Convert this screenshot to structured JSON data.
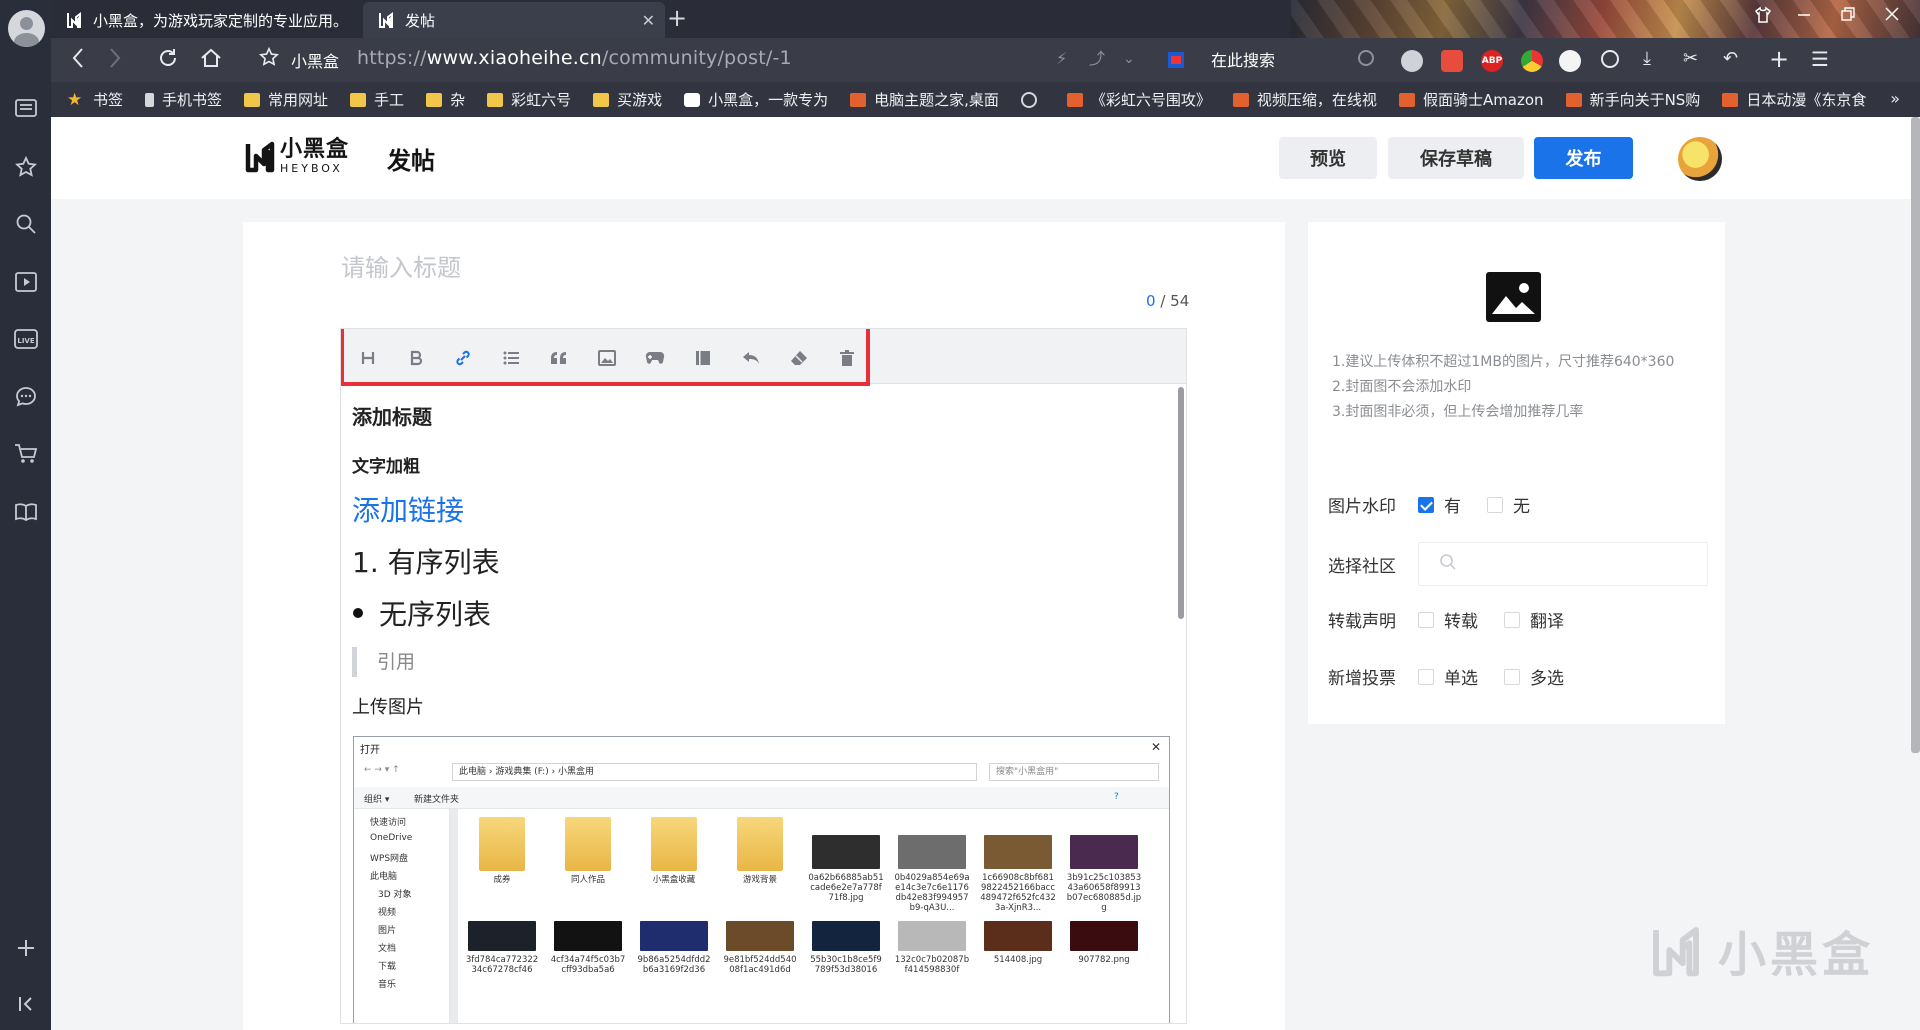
{
  "browser": {
    "tabs": [
      {
        "title": "小黑盒，为游戏玩家定制的专业应用。",
        "active": false
      },
      {
        "title": "发帖",
        "active": true
      }
    ],
    "site_name": "小黑盒",
    "url_prefix": "https://",
    "url_domain": "www.xiaoheihe.cn",
    "url_path": "/community/post/-1",
    "search_placeholder": "在此搜索",
    "bookmarks": [
      {
        "label": "书签",
        "icon": "star-icon"
      },
      {
        "label": "手机书签",
        "icon": "phone-icon"
      },
      {
        "label": "常用网址",
        "icon": "folder-icon"
      },
      {
        "label": "手工",
        "icon": "folder-icon"
      },
      {
        "label": "杂",
        "icon": "folder-icon"
      },
      {
        "label": "彩虹六号",
        "icon": "folder-icon"
      },
      {
        "label": "买游戏",
        "icon": "folder-icon"
      },
      {
        "label": "小黑盒，一款专为",
        "icon": "heybox-icon"
      },
      {
        "label": "电脑主题之家,桌面",
        "icon": "site-icon"
      },
      {
        "label": "",
        "icon": "globe-icon"
      },
      {
        "label": "《彩虹六号围攻》",
        "icon": "site-icon"
      },
      {
        "label": "视频压缩，在线视",
        "icon": "site-icon"
      },
      {
        "label": "假面骑士Amazon",
        "icon": "site-icon"
      },
      {
        "label": "新手向关于NS购",
        "icon": "site-icon"
      },
      {
        "label": "日本动漫《东京食",
        "icon": "site-icon"
      }
    ]
  },
  "header": {
    "logo_cn": "小黑盒",
    "logo_en": "HEYBOX",
    "page_title": "发帖",
    "preview_label": "预览",
    "save_draft_label": "保存草稿",
    "publish_label": "发布"
  },
  "editor": {
    "title_placeholder": "请输入标题",
    "title_count": "0",
    "title_max": "/ 54",
    "toolbar": [
      "heading",
      "bold",
      "link",
      "list",
      "quote",
      "image",
      "game",
      "book",
      "undo",
      "eraser",
      "delete"
    ],
    "content": {
      "heading": "添加标题",
      "bold": "文字加粗",
      "link": "添加链接",
      "ordered": "1. 有序列表",
      "unordered": "无序列表",
      "quote": "引用",
      "upload": "上传图片"
    },
    "dialog": {
      "title": "打开",
      "path": "此电脑 › 游戏典集 (F:) › 小黑盒用",
      "search": "搜索\"小黑盒用\"",
      "organize": "组织 ▾",
      "new_folder": "新建文件夹",
      "nav": [
        "快速访问",
        "OneDrive",
        "WPS网盘",
        "此电脑",
        "3D 对象",
        "视频",
        "图片",
        "文档",
        "下载",
        "音乐"
      ],
      "files_row1": [
        {
          "name": "成券",
          "kind": "folder"
        },
        {
          "name": "同人作品",
          "kind": "folder"
        },
        {
          "name": "小黑盒收藏",
          "kind": "folder"
        },
        {
          "name": "游戏背景",
          "kind": "folder"
        },
        {
          "name": "0a62b66885ab51cade6e2e7a778f71f8.jpg",
          "kind": "image",
          "color": "#2e2e2e"
        },
        {
          "name": "0b4029a854e69ae14c3e7c6e1176db42e83f994957b9-qA3U...",
          "kind": "image",
          "color": "#6d6d6d"
        },
        {
          "name": "1c66908c8bf6819822452166bacc489472f652fc4323a-XjnR3...",
          "kind": "image",
          "color": "#7a5a32"
        },
        {
          "name": "3b91c25c10385343a60658f89913b07ec680885d.jpg",
          "kind": "image",
          "color": "#4a2a4e"
        }
      ],
      "files_row2": [
        {
          "name": "3fd784ca77232234c67278cf46",
          "color": "#1d2129"
        },
        {
          "name": "4cf34a74f5c03b7cff93dba5a6",
          "color": "#121212"
        },
        {
          "name": "9b86a5254dfdd2b6a3169f2d36",
          "color": "#1f2c6e"
        },
        {
          "name": "9e81bf524dd54008f1ac491d6d",
          "color": "#6b4b2a"
        },
        {
          "name": "55b30c1b8ce5f9789f53d38016",
          "color": "#13243e"
        },
        {
          "name": "132c0c7b02087bf414598830f",
          "color": "#b8b8b8"
        },
        {
          "name": "514408.jpg",
          "color": "#5a2e1a"
        },
        {
          "name": "907782.png",
          "color": "#3a0c10"
        }
      ]
    }
  },
  "side": {
    "cover_tips": [
      "1.建议上传体积不超过1MB的图片，尺寸推荐640*360",
      "2.封面图不会添加水印",
      "3.封面图非必须，但上传会增加推荐几率"
    ],
    "watermark_label": "图片水印",
    "watermark_yes": "有",
    "watermark_no": "无",
    "community_label": "选择社区",
    "repost_label": "转载声明",
    "repost_opt1": "转载",
    "repost_opt2": "翻译",
    "vote_label": "新增投票",
    "vote_single": "单选",
    "vote_multi": "多选"
  },
  "watermark_text": "小黑盒",
  "colors": {
    "accent": "#1a73e8",
    "highlight": "#e8303b",
    "sidebar": "#2a2e3b"
  }
}
